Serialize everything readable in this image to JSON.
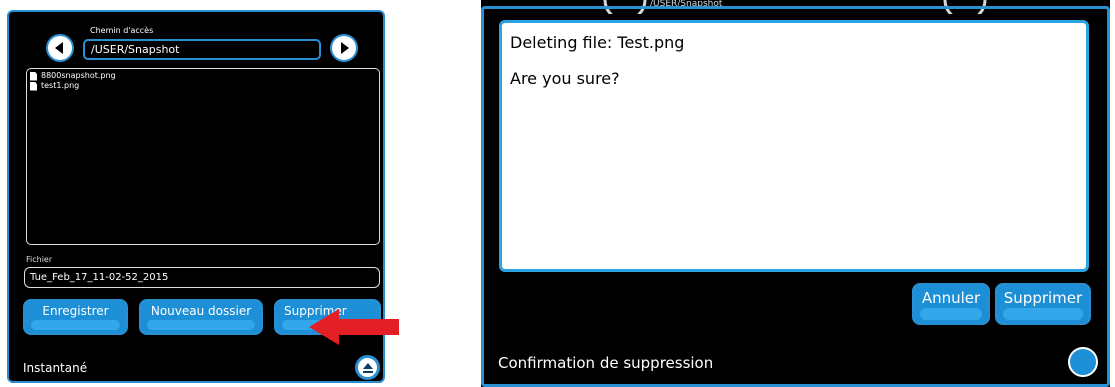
{
  "left": {
    "path_label": "Chemin d'accès",
    "path_value": "/USER/Snapshot",
    "files": [
      "8800snapshot.png",
      "test1.png"
    ],
    "filename_label": "Fichier",
    "filename_value": "Tue_Feb_17_11-02-52_2015",
    "buttons": {
      "save": "Enregistrer",
      "new_folder": "Nouveau dossier",
      "delete": "Supprimer"
    },
    "status": "Instantané"
  },
  "right": {
    "background_path": "/USER/Snapshot",
    "dialog": {
      "line1": "Deleting file: Test.png",
      "line2": "Are you sure?"
    },
    "buttons": {
      "cancel": "Annuler",
      "confirm": "Supprimer"
    },
    "status": "Confirmation de suppression"
  },
  "colors": {
    "accent": "#2a8fd0",
    "button_fill": "#1d8fd6",
    "arrow": "#e31e24"
  },
  "icons": [
    "arrow-left-icon",
    "arrow-right-icon",
    "file-icon",
    "collapse-icon",
    "red-arrow-icon"
  ]
}
